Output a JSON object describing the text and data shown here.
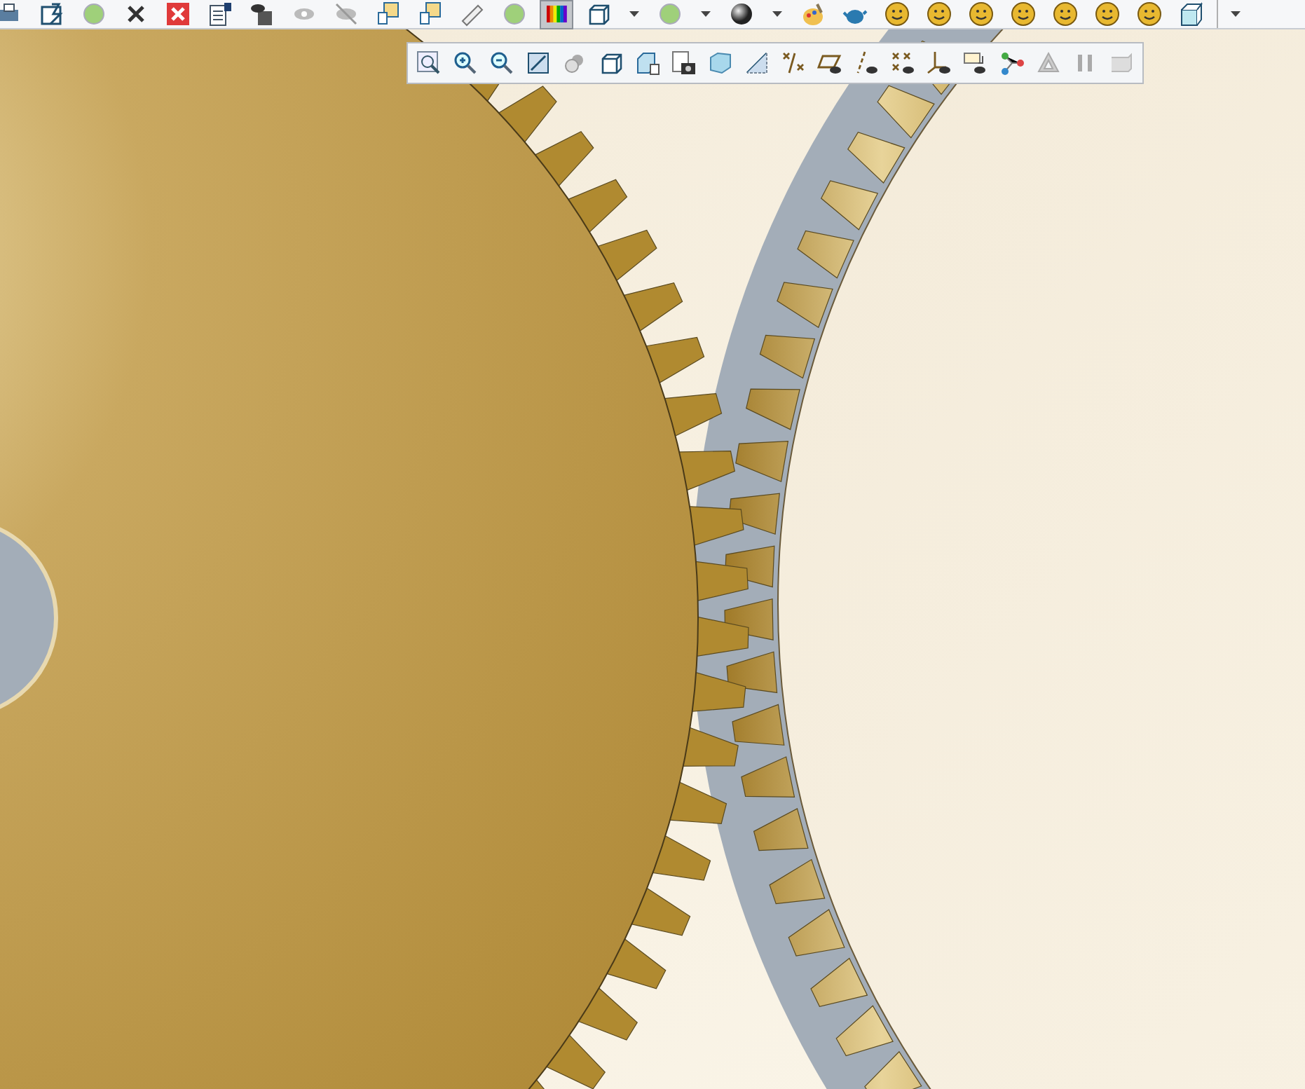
{
  "top_toolbar": {
    "buttons": [
      {
        "kind": "printer",
        "selected": false
      },
      {
        "kind": "regenerate",
        "selected": false
      },
      {
        "kind": "globe",
        "selected": false
      },
      {
        "kind": "x",
        "selected": false
      },
      {
        "kind": "close",
        "selected": false
      },
      {
        "kind": "info",
        "selected": false
      },
      {
        "kind": "save",
        "selected": false
      },
      {
        "kind": "eye",
        "selected": false
      },
      {
        "kind": "eye-off",
        "selected": false
      },
      {
        "kind": "layers",
        "selected": false
      },
      {
        "kind": "layers",
        "selected": false
      },
      {
        "kind": "ruler",
        "selected": false
      },
      {
        "kind": "globe",
        "selected": false
      },
      {
        "kind": "colorbar",
        "selected": true
      },
      {
        "kind": "cube",
        "selected": false
      },
      {
        "kind": "caret",
        "selected": false
      },
      {
        "kind": "globe",
        "selected": false
      },
      {
        "kind": "caret",
        "selected": false
      },
      {
        "kind": "sphere",
        "selected": false
      },
      {
        "kind": "caret",
        "selected": false
      },
      {
        "kind": "palette",
        "selected": false
      },
      {
        "kind": "teapot",
        "selected": false
      },
      {
        "kind": "smiley",
        "selected": false
      },
      {
        "kind": "smiley",
        "selected": false
      },
      {
        "kind": "smiley",
        "selected": false
      },
      {
        "kind": "smiley",
        "selected": false
      },
      {
        "kind": "smiley",
        "selected": false
      },
      {
        "kind": "smiley",
        "selected": false
      },
      {
        "kind": "smiley",
        "selected": false
      },
      {
        "kind": "box",
        "selected": false
      }
    ],
    "overflow": {
      "kind": "caret"
    }
  },
  "view_toolbar": {
    "buttons": [
      {
        "kind": "zoom-fit"
      },
      {
        "kind": "zoom-in"
      },
      {
        "kind": "zoom-out"
      },
      {
        "kind": "repaint"
      },
      {
        "kind": "spheres"
      },
      {
        "kind": "cube"
      },
      {
        "kind": "cube-list"
      },
      {
        "kind": "camera"
      },
      {
        "kind": "glass-cube"
      },
      {
        "kind": "plane"
      },
      {
        "kind": "points"
      },
      {
        "kind": "plane-eye"
      },
      {
        "kind": "axis-eye"
      },
      {
        "kind": "points-eye"
      },
      {
        "kind": "csys-eye"
      },
      {
        "kind": "note"
      },
      {
        "kind": "nodes"
      },
      {
        "kind": "triangle"
      },
      {
        "kind": "pause"
      },
      {
        "kind": "shade"
      }
    ]
  }
}
